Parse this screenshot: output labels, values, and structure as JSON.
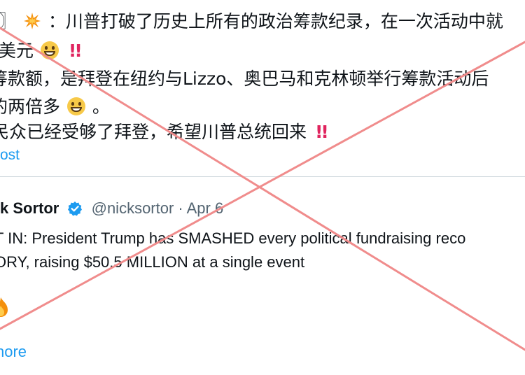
{
  "post": {
    "line1_prefix": "〗",
    "line1_text": "：川普打破了历史上所有的政治筹款纪录，在一次活动中就",
    "line2_text": "美元",
    "line3_text": "筹款额，是拜登在纽约与Lizzo、奥巴马和克林顿举行筹款活动后",
    "line4_text": "的两倍多",
    "line4_suffix": "。",
    "line5_text": "民众已经受够了拜登，希望川普总统回来",
    "bang": "!!",
    "show_post_label": "ost"
  },
  "quote": {
    "name": "k Sortor",
    "handle_date": "@nicksortor · Apr 6",
    "line1": "T IN: President Trump has SMASHED every political fundraising reco",
    "line2": "ORY, raising $50.5 MILLION at a single event",
    "show_more_label": "nore"
  },
  "colors": {
    "link": "#1d9bf0",
    "strike": "#f08c8c",
    "verified": "#1d9bf0"
  },
  "icons": [
    "collision-emoji",
    "grinning-emoji",
    "double-exclamation-emoji",
    "verified-badge-icon",
    "fire-emoji"
  ]
}
